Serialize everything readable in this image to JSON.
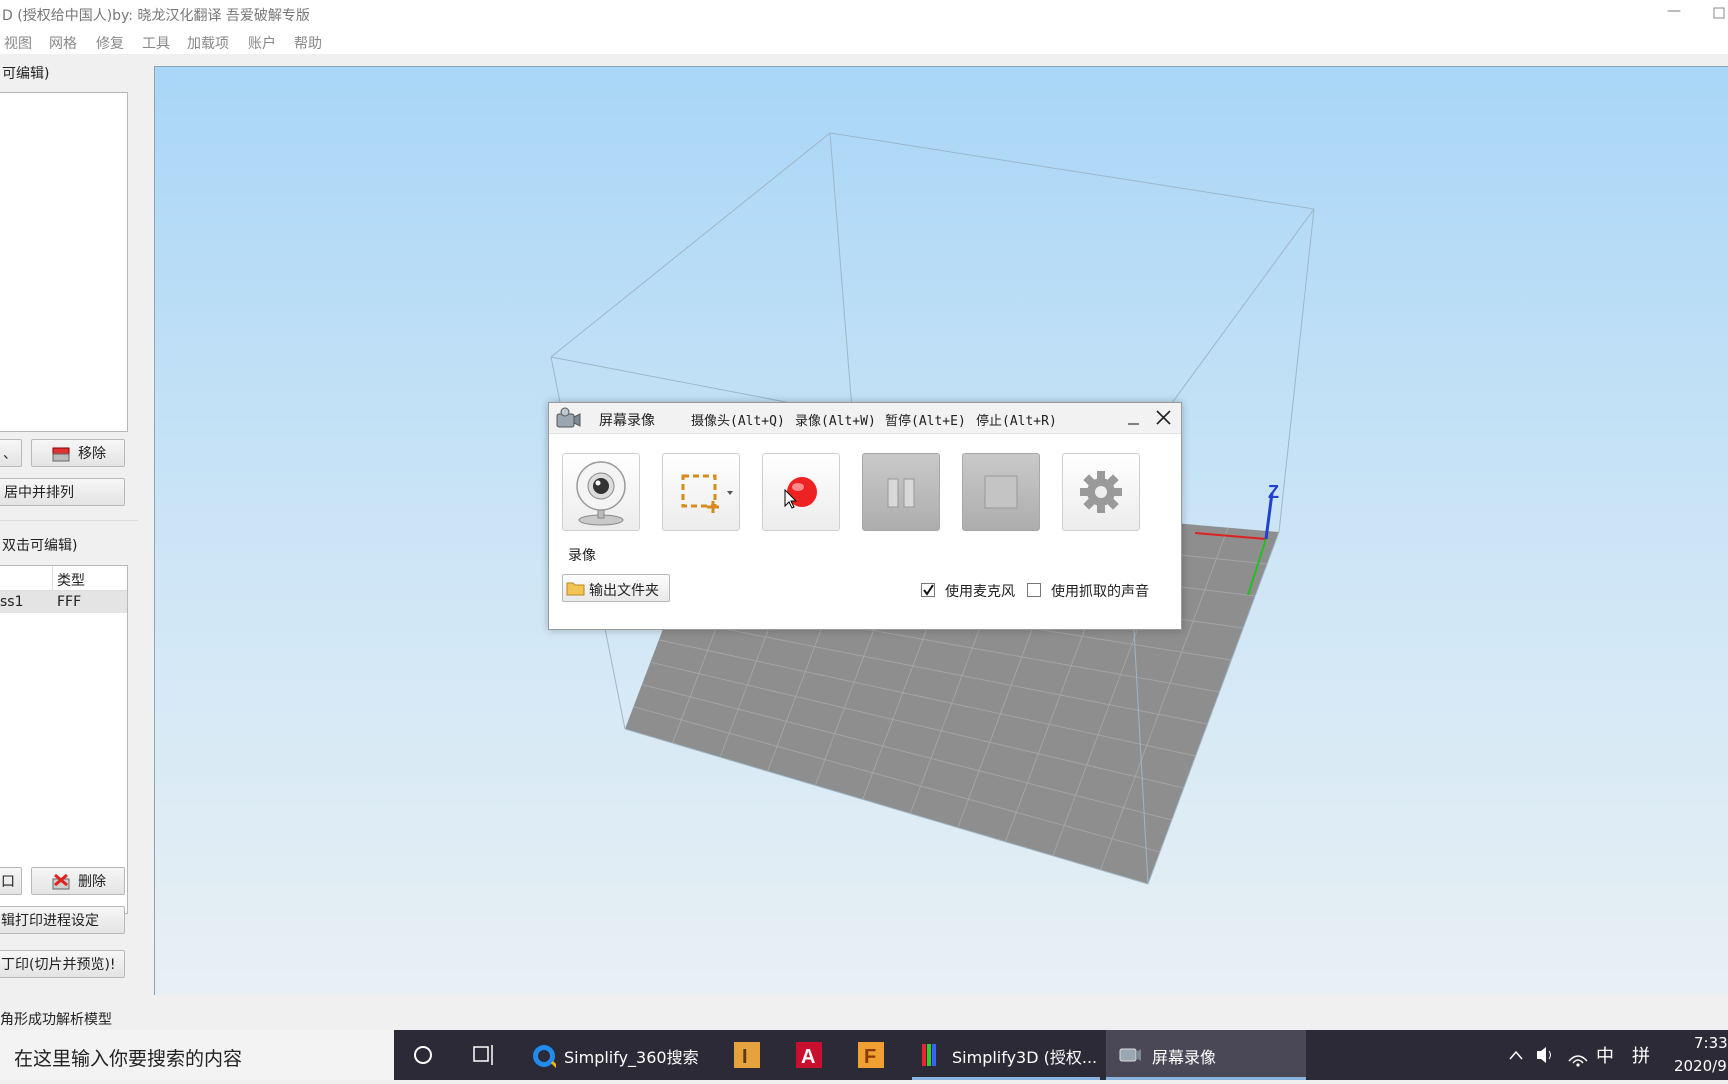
{
  "window": {
    "title": "D (授权给中国人)by: 晓龙汉化翻译  吾爱破解专版",
    "minimize_glyph": "—"
  },
  "menubar": {
    "items": [
      "视图",
      "网格",
      "修复",
      "工具",
      "加载项",
      "账户",
      "帮助"
    ]
  },
  "left_panel": {
    "models_title": "可编辑)",
    "remove_label": "移除",
    "center_arrange_label": "居中并排列",
    "processes_title": "双击可编辑)",
    "process_table": {
      "col_type": "类型",
      "rows": [
        {
          "name": "ss1",
          "type": "FFF"
        }
      ]
    },
    "delete_label": "删除",
    "left_btn_fragment_1": "、",
    "left_btn_fragment_2": "口",
    "edit_process_label": "辑打印进程设定",
    "print_label": "丁印(切片并预览)!"
  },
  "viewport": {
    "axis_z_label": "Z"
  },
  "statusbar": {
    "text": "角形成功解析模型"
  },
  "dialog": {
    "title": "屏幕录像",
    "menu": [
      "摄像头(Alt+Q)",
      "录像(Alt+W)",
      "暂停(Alt+E)",
      "停止(Alt+R)"
    ],
    "record_caption": "录像",
    "output_folder_label": "输出文件夹",
    "use_mic_label": "使用麦克风",
    "use_mic_checked": true,
    "use_capture_sound_label": "使用抓取的声音",
    "use_capture_sound_checked": false
  },
  "taskbar": {
    "search_placeholder": "在这里输入你要搜索的内容",
    "apps": [
      {
        "label": "Simplify_360搜索"
      },
      {
        "label": "Simplify3D (授权..."
      },
      {
        "label": "屏幕录像"
      }
    ],
    "ime": "中",
    "ime2": "拼",
    "time": "7:33",
    "date": "2020/9"
  }
}
